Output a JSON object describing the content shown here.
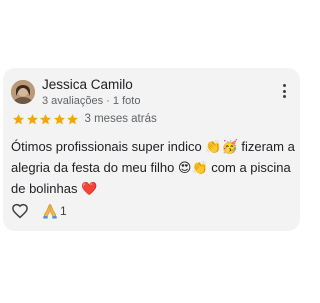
{
  "review": {
    "author": "Jessica Camilo",
    "meta": "3 avaliações · 1 foto",
    "rating": 5,
    "rating_max": 5,
    "date": "3 meses atrás",
    "text": "Ótimos profissionais super indico 👏🥳 fizeram a alegria da festa do meu filho 😍👏 com a piscina de bolinhas ❤️",
    "thanks_count": "1"
  },
  "colors": {
    "star": "#f4a700",
    "card_bg": "#f3f3f3",
    "text": "#202124",
    "secondary_text": "#5f6368"
  },
  "icons": {
    "menu": "more-vert-icon",
    "like": "heart-outline-icon",
    "thanks": "praying-hands-icon"
  }
}
